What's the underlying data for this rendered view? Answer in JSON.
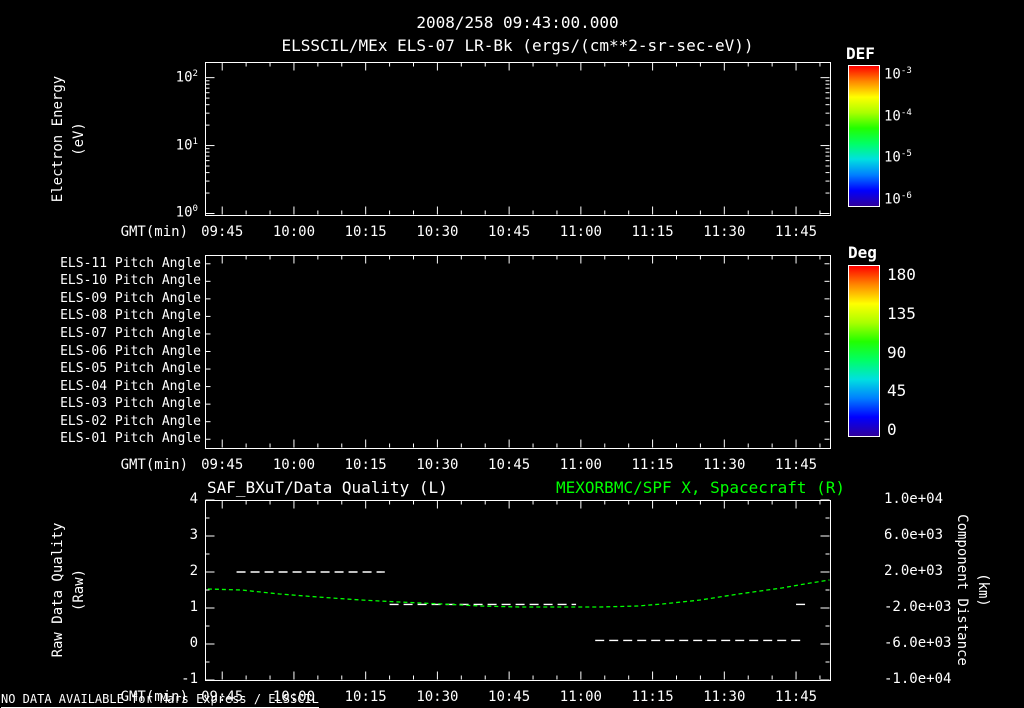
{
  "header": {
    "date": "2008/258 09:43:00.000",
    "title": "ELSSCIL/MEx ELS-07 LR-Bk (ergs/(cm**2-sr-sec-eV))"
  },
  "x_axis": {
    "label": "GMT(min)",
    "tick_labels": [
      "09:45",
      "10:00",
      "10:15",
      "10:30",
      "10:45",
      "11:00",
      "11:15",
      "11:30",
      "11:45"
    ],
    "range_minutes": [
      581.4,
      712.1
    ],
    "major_tick_minutes": 15,
    "minor_tick_minutes": 5
  },
  "colors": {
    "background": "#000000",
    "foreground": "#ffffff",
    "accent_green": "#00ff00",
    "colormap_bottom_to_top": [
      "#30009c",
      "#0000ff",
      "#0080ff",
      "#00e0e0",
      "#00ff66",
      "#22ff00",
      "#aaff00",
      "#ffff00",
      "#ff8800",
      "#ff0000"
    ]
  },
  "chart_data": [
    {
      "type": "heatmap",
      "panel": "energy-spectrogram",
      "title": "ELSSCIL/MEx ELS-07 LR-Bk (ergs/(cm**2-sr-sec-eV))",
      "ylabel_line1": "Electron Energy",
      "ylabel_line2": "(eV)",
      "yscale": "log",
      "ylim": [
        0.95,
        170
      ],
      "ytick_values": [
        1,
        10,
        100
      ],
      "ytick_labels": [
        {
          "base": "10",
          "exp": "0"
        },
        {
          "base": "10",
          "exp": "1"
        },
        {
          "base": "10",
          "exp": "2"
        }
      ],
      "xlabel": "GMT(min)",
      "colorbar": {
        "title": "DEF",
        "scale": "log",
        "unit": "ergs/(cm**2-sr-sec-eV)",
        "tick_labels": [
          {
            "base": "10",
            "exp": "-3"
          },
          {
            "base": "10",
            "exp": "-4"
          },
          {
            "base": "10",
            "exp": "-5"
          },
          {
            "base": "10",
            "exp": "-6"
          }
        ]
      },
      "values": [],
      "note": "panel is empty - no data plotted"
    },
    {
      "type": "heatmap",
      "panel": "pitch-angle",
      "row_labels": [
        "ELS-11 Pitch Angle",
        "ELS-10 Pitch Angle",
        "ELS-09 Pitch Angle",
        "ELS-08 Pitch Angle",
        "ELS-07 Pitch Angle",
        "ELS-06 Pitch Angle",
        "ELS-05 Pitch Angle",
        "ELS-04 Pitch Angle",
        "ELS-03 Pitch Angle",
        "ELS-02 Pitch Angle",
        "ELS-01 Pitch Angle"
      ],
      "xlabel": "GMT(min)",
      "colorbar": {
        "title": "Deg",
        "range": [
          0,
          180
        ],
        "tick_labels": [
          "180",
          "135",
          "90",
          "45",
          "0"
        ]
      },
      "values": [],
      "note": "panel is empty - no data plotted"
    },
    {
      "type": "line",
      "panel": "quality-and-distance",
      "title_left": "SAF_BXuT/Data Quality (L)",
      "title_right": "MEXORBMC/SPF X, Spacecraft (R)",
      "ylabel_left_line1": "Raw Data Quality",
      "ylabel_left_line2": "(Raw)",
      "ylabel_right_line1": "Component Distance",
      "ylabel_right_unit": "(km)",
      "xlabel": "GMT(min)",
      "ylim_left": [
        -1,
        4
      ],
      "ytick_labels_left": [
        "4",
        "3",
        "2",
        "1",
        "0",
        "-1"
      ],
      "ytick_values_left": [
        4,
        3,
        2,
        1,
        0,
        -1
      ],
      "ylim_right": [
        -10000,
        10000
      ],
      "ytick_labels_right": [
        "1.0e+04",
        "6.0e+03",
        "2.0e+03",
        "-2.0e+03",
        "-6.0e+03",
        "-1.0e+04"
      ],
      "ytick_values_right": [
        10000,
        6000,
        2000,
        -2000,
        -6000,
        -10000
      ],
      "quality_segments": [
        {
          "level": 2.0,
          "start": "09:48",
          "end": "10:19"
        },
        {
          "level": 1.1,
          "start": "10:20",
          "end": "10:59"
        },
        {
          "level": 0.1,
          "start": "11:03",
          "end": "11:46"
        },
        {
          "level": 1.1,
          "start": "11:45",
          "end": "11:47"
        }
      ],
      "spacecraft_x": {
        "time": [
          "09:42",
          "09:49",
          "09:57",
          "10:05",
          "10:14",
          "10:22",
          "10:31",
          "10:39",
          "10:47",
          "10:56",
          "11:04",
          "11:12",
          "11:17",
          "11:25",
          "11:33",
          "11:42",
          "11:48",
          "11:52"
        ],
        "km": [
          110,
          0,
          -440,
          -780,
          -1110,
          -1330,
          -1560,
          -1780,
          -1890,
          -1890,
          -1890,
          -1780,
          -1560,
          -1110,
          -440,
          220,
          780,
          1110
        ]
      }
    }
  ],
  "footer": {
    "no_data_notice": "NO DATA AVAILABLE for Mars Express / ELSSCIL"
  }
}
